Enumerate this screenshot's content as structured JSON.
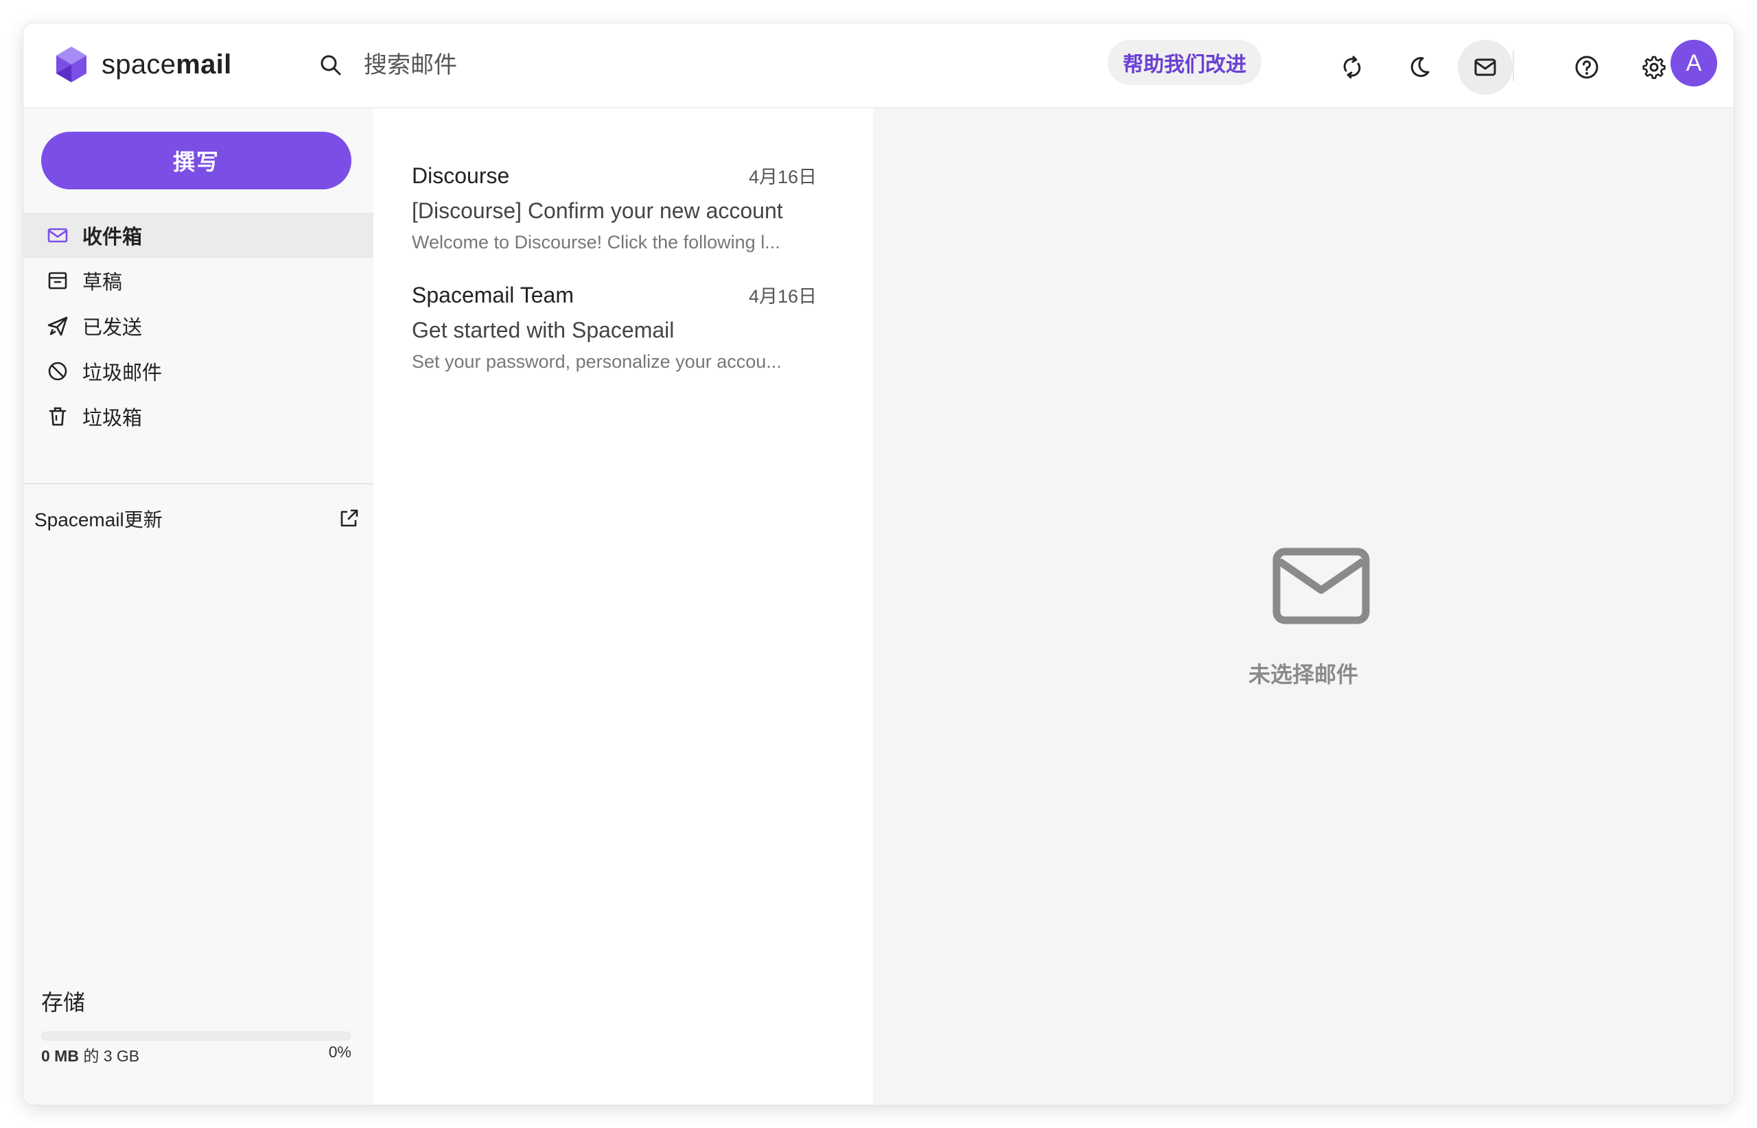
{
  "app": {
    "brand_light": "space",
    "brand_bold": "mail"
  },
  "header": {
    "search_placeholder": "搜索邮件",
    "help_label": "帮助我们改进",
    "avatar_initial": "A"
  },
  "sidebar": {
    "compose_label": "撰写",
    "folders": [
      {
        "label": "收件箱",
        "icon": "inbox-icon",
        "active": true
      },
      {
        "label": "草稿",
        "icon": "drafts-icon"
      },
      {
        "label": "已发送",
        "icon": "sent-icon"
      },
      {
        "label": "垃圾邮件",
        "icon": "spam-icon"
      },
      {
        "label": "垃圾箱",
        "icon": "trash-icon"
      }
    ],
    "updates_label": "Spacemail更新",
    "storage": {
      "title": "存储",
      "used": "0 MB",
      "of": "的 3 GB",
      "percent_label": "0%",
      "fraction": 0
    }
  },
  "messages": [
    {
      "sender": "Discourse",
      "date": "4月16日",
      "subject": "[Discourse] Confirm your new account",
      "preview": "Welcome to Discourse! Click the following l..."
    },
    {
      "sender": "Spacemail Team",
      "date": "4月16日",
      "subject": "Get started with Spacemail",
      "preview": "Set your password, personalize your accou..."
    }
  ],
  "reading_pane": {
    "empty_text": "未选择邮件"
  },
  "colors": {
    "accent": "#7b4fe6",
    "help_text": "#6b3fd4",
    "sidebar_bg": "#f8f8f8",
    "pane_bg": "#f5f5f5"
  }
}
